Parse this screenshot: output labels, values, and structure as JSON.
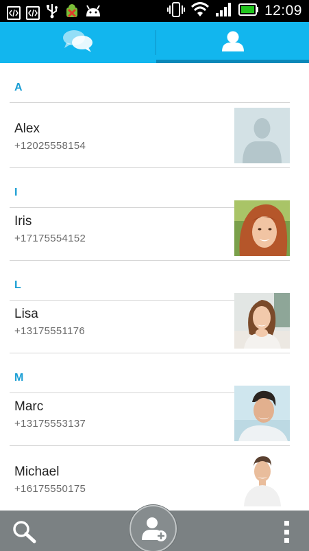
{
  "status_bar": {
    "clock": "12:09",
    "left_icons": [
      "developer-code-icon",
      "developer-code-icon",
      "usb-icon",
      "debug-bug-icon",
      "android-icon"
    ],
    "right_icons": [
      "vibrate-icon",
      "wifi-icon",
      "signal-icon",
      "battery-icon"
    ]
  },
  "tabs": [
    {
      "name": "chats",
      "icon": "chat-bubbles-icon",
      "selected": false
    },
    {
      "name": "contacts",
      "icon": "person-icon",
      "selected": true
    }
  ],
  "contacts": {
    "sections": [
      {
        "letter": "A",
        "entries": [
          {
            "name": "Alex",
            "phone": "+12025558154",
            "avatar": "default-avatar-icon"
          }
        ]
      },
      {
        "letter": "I",
        "entries": [
          {
            "name": "Iris",
            "phone": "+17175554152",
            "avatar": "photo"
          }
        ]
      },
      {
        "letter": "L",
        "entries": [
          {
            "name": "Lisa",
            "phone": "+13175551176",
            "avatar": "photo"
          }
        ]
      },
      {
        "letter": "M",
        "entries": [
          {
            "name": "Marc",
            "phone": "+13175553137",
            "avatar": "photo"
          },
          {
            "name": "Michael",
            "phone": "+16175550175",
            "avatar": "photo"
          }
        ]
      }
    ]
  },
  "bottom_bar": {
    "left_icon": "search-icon",
    "center_icon": "add-contact-icon",
    "right_icon": "overflow-menu-icon"
  },
  "colors": {
    "tab_bar": "#12b6ee",
    "tab_indicator": "#0a88b9",
    "section_letter": "#1a9ed4",
    "bottom_bar": "#7b8183",
    "battery": "#22c51e"
  }
}
